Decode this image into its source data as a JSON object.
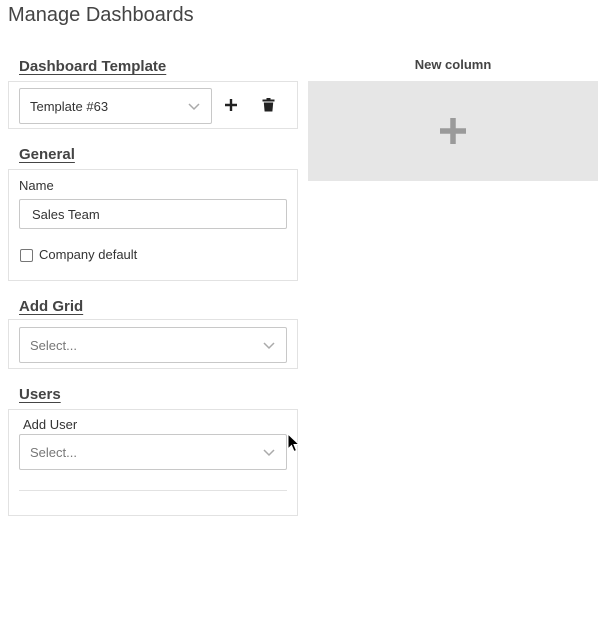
{
  "page": {
    "title": "Manage Dashboards"
  },
  "template_section": {
    "title": "Dashboard Template",
    "selected": "Template #63",
    "icons": {
      "add": "plus-icon",
      "delete": "trash-icon",
      "chevron": "chevron-down-icon"
    }
  },
  "general": {
    "title": "General",
    "name_label": "Name",
    "name_value": "Sales Team",
    "company_default_label": "Company default",
    "company_default_checked": false
  },
  "add_grid": {
    "title": "Add Grid",
    "placeholder": "Select..."
  },
  "users": {
    "title": "Users",
    "add_user_label": "Add User",
    "placeholder": "Select..."
  },
  "new_column": {
    "title": "New column",
    "icon": "plus-icon"
  },
  "colors": {
    "panel_border": "#e2e2e2",
    "column_bg": "#e6e6e6",
    "plus_big": "#9a9a9a",
    "text": "#444444"
  }
}
